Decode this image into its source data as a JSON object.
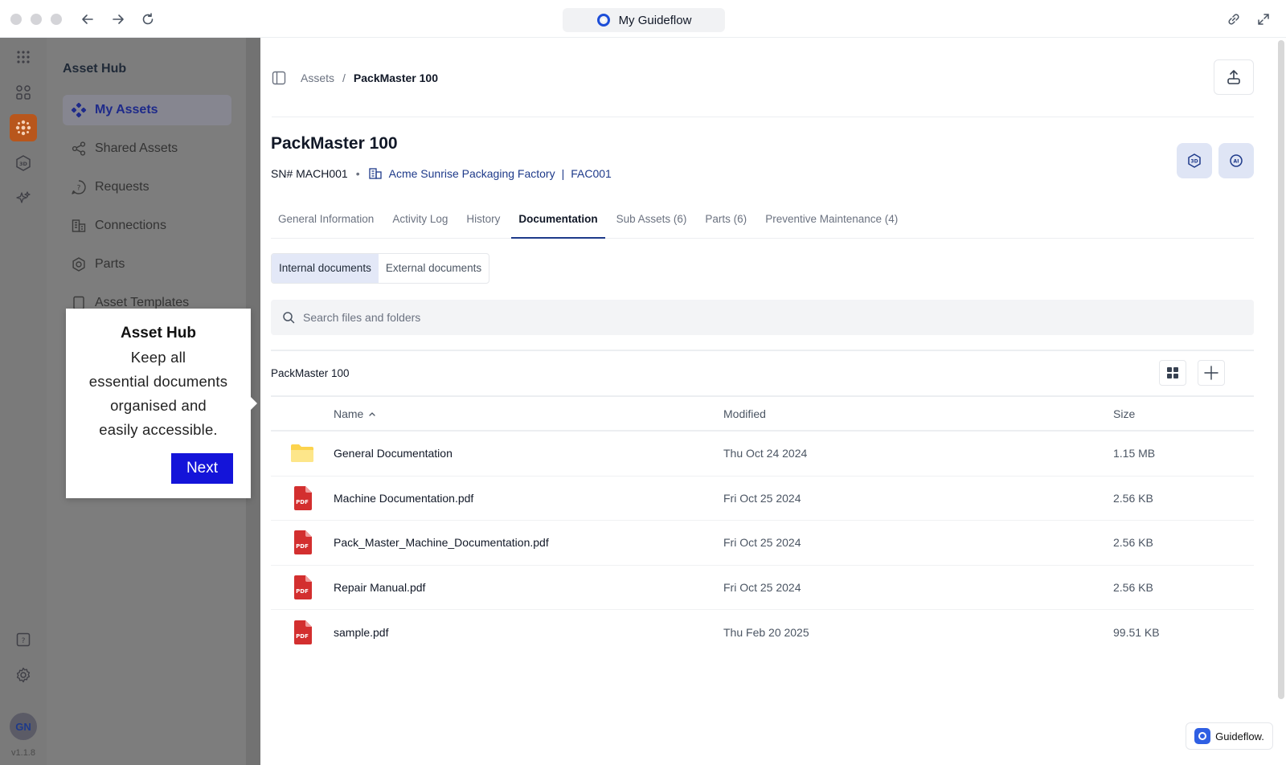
{
  "browser": {
    "title": "My Guideflow"
  },
  "rail": {
    "avatar_initials": "GN",
    "version": "v1.1.8"
  },
  "nav": {
    "title": "Asset Hub",
    "items": [
      {
        "label": "My Assets",
        "icon": "assets-icon",
        "active": true
      },
      {
        "label": "Shared Assets",
        "icon": "share-icon"
      },
      {
        "label": "Requests",
        "icon": "question-icon"
      },
      {
        "label": "Connections",
        "icon": "building-icon"
      },
      {
        "label": "Parts",
        "icon": "gear-icon"
      },
      {
        "label": "Asset Templates",
        "icon": "template-icon"
      }
    ]
  },
  "tooltip": {
    "title": "Asset Hub",
    "line1": "Keep all",
    "line2": "essential documents",
    "line3": "organised and",
    "line4": "easily accessible.",
    "next_label": "Next"
  },
  "breadcrumb": {
    "parent": "Assets",
    "separator": "/",
    "current": "PackMaster 100"
  },
  "asset": {
    "title": "PackMaster 100",
    "serial": "SN# MACH001",
    "location": "Acme Sunrise Packaging Factory",
    "location_sep": "|",
    "location_code": "FAC001"
  },
  "tabs": [
    {
      "label": "General Information"
    },
    {
      "label": "Activity Log"
    },
    {
      "label": "History"
    },
    {
      "label": "Documentation",
      "active": true
    },
    {
      "label": "Sub Assets (6)"
    },
    {
      "label": "Parts (6)"
    },
    {
      "label": "Preventive Maintenance (4)"
    }
  ],
  "doc_toggle": {
    "internal": "Internal documents",
    "external": "External documents"
  },
  "search": {
    "placeholder": "Search files and folders"
  },
  "folder": {
    "label": "PackMaster 100"
  },
  "table": {
    "headers": {
      "name": "Name",
      "modified": "Modified",
      "size": "Size"
    },
    "rows": [
      {
        "type": "folder",
        "name": "General Documentation",
        "modified": "Thu Oct 24 2024",
        "size": "1.15 MB"
      },
      {
        "type": "pdf",
        "name": "Machine Documentation.pdf",
        "modified": "Fri Oct 25 2024",
        "size": "2.56 KB"
      },
      {
        "type": "pdf",
        "name": "Pack_Master_Machine_Documentation.pdf",
        "modified": "Fri Oct 25 2024",
        "size": "2.56 KB"
      },
      {
        "type": "pdf",
        "name": "Repair Manual.pdf",
        "modified": "Fri Oct 25 2024",
        "size": "2.56 KB"
      },
      {
        "type": "pdf",
        "name": "sample.pdf",
        "modified": "Thu Feb 20 2025",
        "size": "99.51 KB"
      }
    ]
  },
  "badge": {
    "label": "Guideflow."
  },
  "colors": {
    "accent": "#1e3a8a",
    "next_button": "#1414d9",
    "rail_active": "#b8561c",
    "pdf_red": "#d32f2f",
    "folder_yellow": "#fcd34d"
  }
}
